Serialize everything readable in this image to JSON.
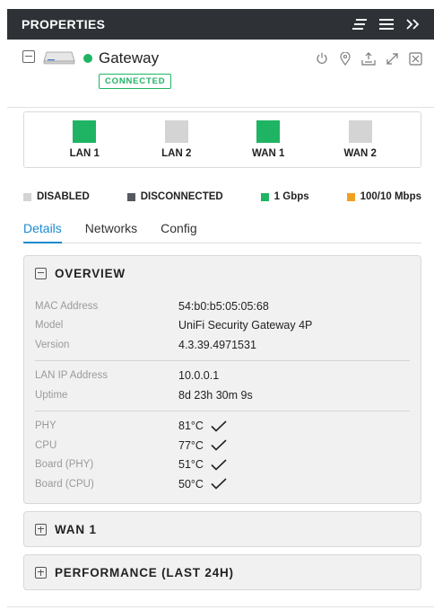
{
  "header": {
    "title": "PROPERTIES",
    "icons": [
      "sort-icon",
      "menu-icon",
      "collapse-panel-icon"
    ]
  },
  "device": {
    "name": "Gateway",
    "status": "CONNECTED",
    "status_color": "#1fb463",
    "actions": [
      "restart-icon",
      "locate-icon",
      "upload-icon",
      "expand-icon",
      "close-icon"
    ]
  },
  "ports": [
    {
      "label": "LAN 1",
      "state": "1 Gbps",
      "color": "#1fb463"
    },
    {
      "label": "LAN 2",
      "state": "DISABLED",
      "color": "#d4d4d4"
    },
    {
      "label": "WAN 1",
      "state": "1 Gbps",
      "color": "#1fb463"
    },
    {
      "label": "WAN 2",
      "state": "DISABLED",
      "color": "#d4d4d4"
    }
  ],
  "legend": [
    {
      "label": "DISABLED",
      "color": "#d4d4d4"
    },
    {
      "label": "DISCONNECTED",
      "color": "#555a60"
    },
    {
      "label": "1 Gbps",
      "color": "#1fb463"
    },
    {
      "label": "100/10 Mbps",
      "color": "#f0a020"
    }
  ],
  "tabs": [
    {
      "label": "Details",
      "active": true
    },
    {
      "label": "Networks",
      "active": false
    },
    {
      "label": "Config",
      "active": false
    }
  ],
  "overview": {
    "title": "OVERVIEW",
    "group1": [
      {
        "key": "MAC Address",
        "value": "54:b0:b5:05:05:68"
      },
      {
        "key": "Model",
        "value": "UniFi Security Gateway 4P"
      },
      {
        "key": "Version",
        "value": "4.3.39.4971531"
      }
    ],
    "group2": [
      {
        "key": "LAN IP Address",
        "value": "10.0.0.1"
      },
      {
        "key": "Uptime",
        "value": "8d 23h 30m 9s"
      }
    ],
    "group3": [
      {
        "key": "PHY",
        "value": "81°C"
      },
      {
        "key": "CPU",
        "value": "77°C"
      },
      {
        "key": "Board (PHY)",
        "value": "51°C"
      },
      {
        "key": "Board (CPU)",
        "value": "50°C"
      }
    ]
  },
  "sections": {
    "wan1": "WAN 1",
    "performance": "PERFORMANCE (LAST 24H)"
  },
  "colors": {
    "header_bg": "#2e3236",
    "accent": "#1a8ad1",
    "green": "#1fb463"
  }
}
